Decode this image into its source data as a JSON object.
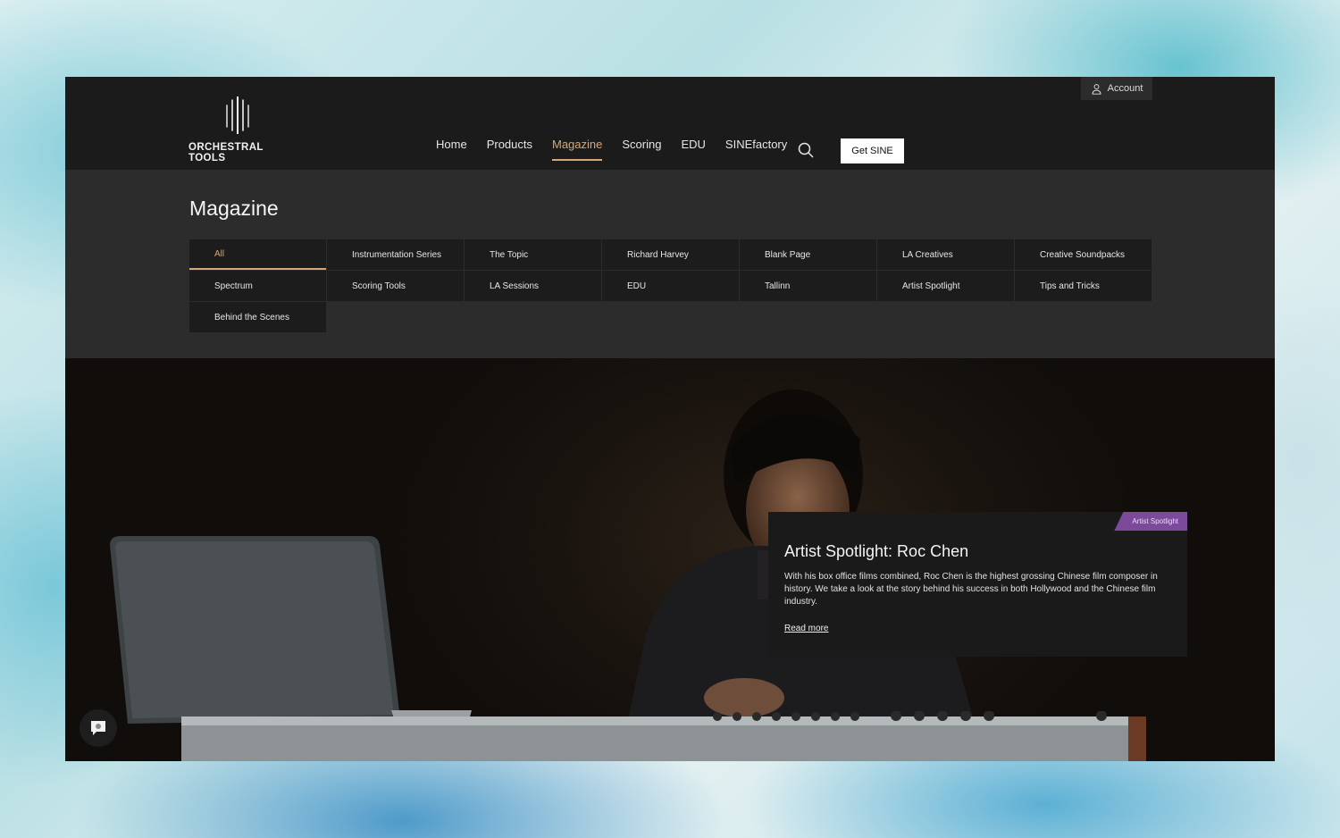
{
  "header": {
    "account_label": "Account",
    "logo_text": "ORCHESTRAL TOOLS",
    "nav": [
      {
        "label": "Home"
      },
      {
        "label": "Products"
      },
      {
        "label": "Magazine",
        "active": true
      },
      {
        "label": "Scoring"
      },
      {
        "label": "EDU"
      },
      {
        "label": "SINEfactory"
      }
    ],
    "cta_label": "Get SINE"
  },
  "magazine": {
    "title": "Magazine",
    "categories": [
      "All",
      "Instrumentation Series",
      "The Topic",
      "Richard Harvey",
      "Blank Page",
      "LA Creatives",
      "Creative Soundpacks",
      "Spectrum",
      "Scoring Tools",
      "LA Sessions",
      "EDU",
      "Tallinn",
      "Artist Spotlight",
      "Tips and Tricks",
      "Behind the Scenes"
    ],
    "active_category": "All"
  },
  "feature": {
    "badge": "Artist Spotlight",
    "title": "Artist Spotlight: Roc Chen",
    "description": "With his box office films combined, Roc Chen is the highest grossing Chinese film composer in history. We take a look at the story behind his success in both Hollywood and the Chinese film industry.",
    "link_label": "Read more"
  },
  "colors": {
    "accent": "#d4a877",
    "badge": "#7b4a9b",
    "background": "#1b1b1b",
    "panel": "#2c2c2c"
  },
  "icons": [
    "user-icon",
    "search-icon",
    "logo-icon",
    "chat-icon"
  ]
}
